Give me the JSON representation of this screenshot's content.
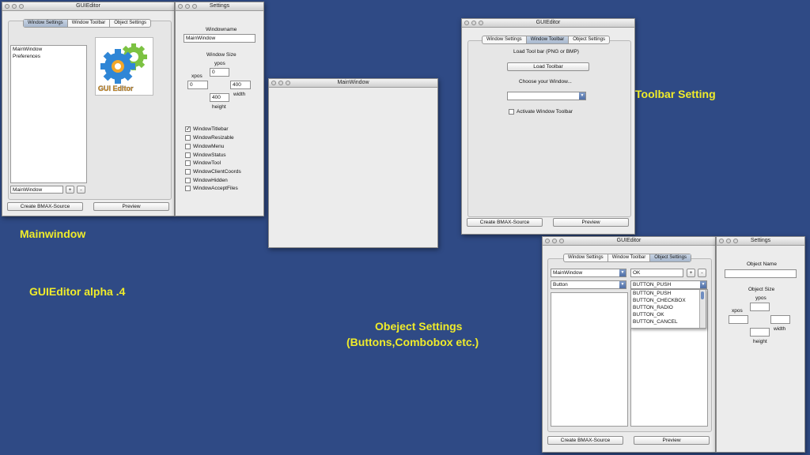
{
  "main_editor": {
    "title": "GUIEditor",
    "tabs": [
      "Window Settings",
      "Window Toolbar",
      "Object Settings"
    ],
    "window_list": [
      "MainWindow",
      "Preferences"
    ],
    "name_field": "MainWindow",
    "plus": "+",
    "minus": "-",
    "logo_text": "GUI Editor",
    "create_button": "Create BMAX-Source",
    "preview_button": "Preview"
  },
  "window_settings": {
    "title": "Settings",
    "windowname_label": "Windowname",
    "windowname_value": "MainWindow",
    "window_size_label": "Window Size",
    "ypos_label": "ypos",
    "ypos_value": "0",
    "xpos_label": "xpos",
    "xpos_value": "0",
    "width_value": "400",
    "width_label": "width",
    "height_value": "400",
    "height_label": "height",
    "checkboxes": [
      {
        "label": "WindowTitlebar",
        "checked": true
      },
      {
        "label": "WindowResizable",
        "checked": false
      },
      {
        "label": "WindowMenu",
        "checked": false
      },
      {
        "label": "WindowStatus",
        "checked": false
      },
      {
        "label": "WindowTool",
        "checked": false
      },
      {
        "label": "WindowClientCoords",
        "checked": false
      },
      {
        "label": "WindowHidden",
        "checked": false
      },
      {
        "label": "WindowAcceptFiles",
        "checked": false
      }
    ]
  },
  "preview_window": {
    "title": "MainWindow"
  },
  "toolbar_editor": {
    "title": "GUIEditor",
    "tabs": [
      "Window Settings",
      "Window Toolbar",
      "Object Settings"
    ],
    "load_label": "Load Tool bar (PNG or BMP)",
    "load_button": "Load Toolbar",
    "choose_label": "Choose your Window...",
    "combo_value": "",
    "activate_label": "Activate Window Toolbar",
    "create_button": "Create BMAX-Source",
    "preview_button": "Preview"
  },
  "object_editor": {
    "title": "GUIEditor",
    "tabs": [
      "Window Settings",
      "Window Toolbar",
      "Object Settings"
    ],
    "window_combo": "MainWindow",
    "type_combo": "Button",
    "name_field": "OK",
    "plus": "+",
    "minus": "-",
    "style_combo": "BUTTON_PUSH",
    "dropdown_items": [
      "BUTTON_PUSH",
      "BUTTON_CHECKBOX",
      "BUTTON_RADIO",
      "BUTTON_OK",
      "BUTTON_CANCEL"
    ],
    "create_button": "Create BMAX-Source",
    "preview_button": "Preview"
  },
  "object_settings": {
    "title": "Settings",
    "object_name_label": "Object Name",
    "object_size_label": "Object Size",
    "ypos_label": "ypos",
    "xpos_label": "xpos",
    "width_label": "width",
    "height_label": "height"
  },
  "captions": {
    "mainwindow": "Mainwindow",
    "version": "GUIEditor alpha .4",
    "toolbar": "Toolbar Setting",
    "object_line1": "Obeject Settings",
    "object_line2": "(Buttons,Combobox etc.)"
  },
  "colors": {
    "background": "#2f4a85",
    "caption": "#f0ec2a",
    "tab_active": "#a7b7cd"
  }
}
